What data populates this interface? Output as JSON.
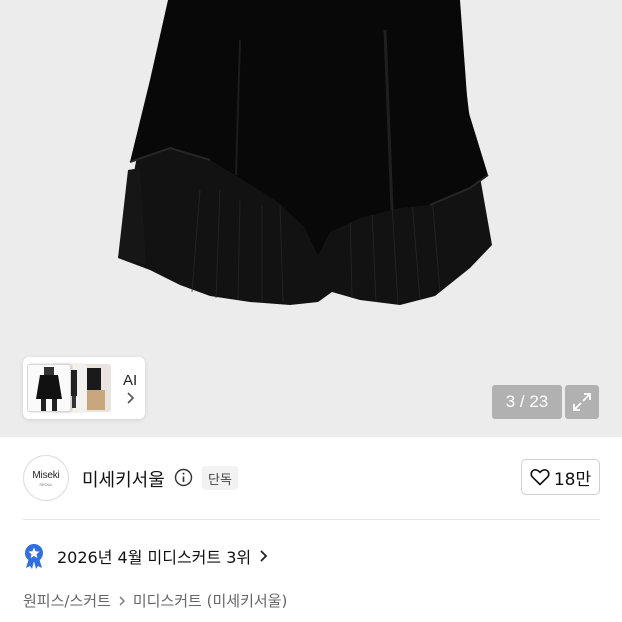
{
  "gallery": {
    "ai_label": "AI",
    "counter": "3 / 23",
    "expand_icon": "expand-icon"
  },
  "seller": {
    "logo_text": "Miseki",
    "logo_subtext": "SEOUL",
    "name": "미세키서울",
    "badge": "단독",
    "likes": "18만"
  },
  "ranking": {
    "text": "2026년 4월 미디스커트 3위"
  },
  "breadcrumb": {
    "items": [
      "원피스/스커트",
      "미디스커트 (미세키서울)"
    ]
  },
  "colors": {
    "image_bg": "#ececec",
    "skirt": "#0d0d0d",
    "rank_badge": "#2f6fe0"
  }
}
